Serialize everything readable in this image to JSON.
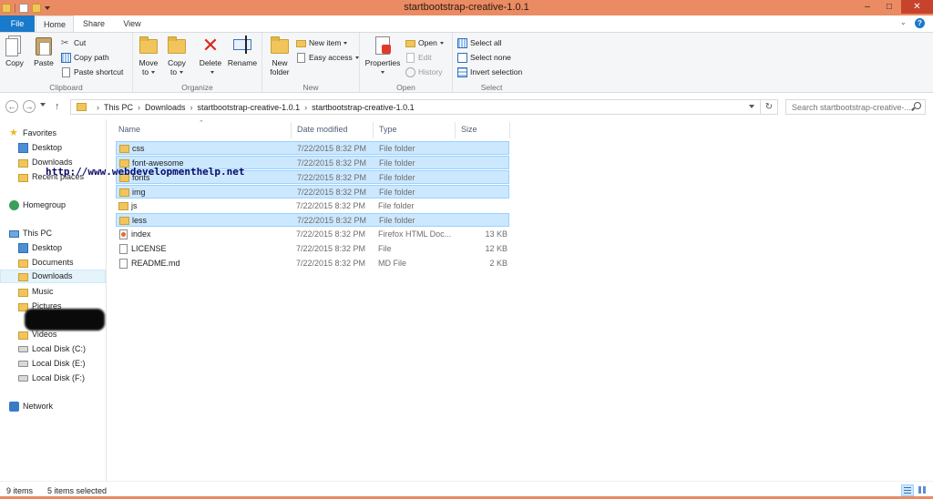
{
  "window": {
    "title": "startbootstrap-creative-1.0.1",
    "minimize": "–",
    "maximize": "□",
    "close": "✕"
  },
  "tabs": [
    "File",
    "Home",
    "Share",
    "View"
  ],
  "ribbon": {
    "clipboard": {
      "label": "Clipboard",
      "copy": "Copy",
      "paste": "Paste",
      "cut": "Cut",
      "copy_path": "Copy path",
      "paste_shortcut": "Paste shortcut"
    },
    "organize": {
      "label": "Organize",
      "move_to": "Move",
      "move_to_2": "to",
      "copy_to": "Copy",
      "copy_to_2": "to",
      "delete": "Delete",
      "rename": "Rename"
    },
    "new": {
      "label": "New",
      "new_folder": "New",
      "new_folder_2": "folder",
      "new_item": "New item",
      "easy_access": "Easy access"
    },
    "open": {
      "label": "Open",
      "properties": "Properties",
      "open": "Open",
      "edit": "Edit",
      "history": "History"
    },
    "select": {
      "label": "Select",
      "select_all": "Select all",
      "select_none": "Select none",
      "invert_selection": "Invert selection"
    }
  },
  "address": {
    "breadcrumbs": [
      "This PC",
      "Downloads",
      "startbootstrap-creative-1.0.1",
      "startbootstrap-creative-1.0.1"
    ],
    "search_placeholder": "Search startbootstrap-creative-..."
  },
  "nav": {
    "favorites": "Favorites",
    "desktop": "Desktop",
    "downloads": "Downloads",
    "recent_places": "Recent places",
    "homegroup": "Homegroup",
    "this_pc": "This PC",
    "pc_desktop": "Desktop",
    "documents": "Documents",
    "pc_downloads": "Downloads",
    "music": "Music",
    "pictures": "Pictures",
    "videos": "Videos",
    "disk_c": "Local Disk (C:)",
    "disk_e": "Local Disk (E:)",
    "disk_f": "Local Disk (F:)",
    "network": "Network"
  },
  "columns": {
    "name": "Name",
    "date": "Date modified",
    "type": "Type",
    "size": "Size"
  },
  "files": [
    {
      "name": "css",
      "date": "7/22/2015 8:32 PM",
      "type": "File folder",
      "size": ""
    },
    {
      "name": "font-awesome",
      "date": "7/22/2015 8:32 PM",
      "type": "File folder",
      "size": ""
    },
    {
      "name": "fonts",
      "date": "7/22/2015 8:32 PM",
      "type": "File folder",
      "size": ""
    },
    {
      "name": "img",
      "date": "7/22/2015 8:32 PM",
      "type": "File folder",
      "size": ""
    },
    {
      "name": "js",
      "date": "7/22/2015 8:32 PM",
      "type": "File folder",
      "size": ""
    },
    {
      "name": "less",
      "date": "7/22/2015 8:32 PM",
      "type": "File folder",
      "size": ""
    },
    {
      "name": "index",
      "date": "7/22/2015 8:32 PM",
      "type": "Firefox HTML Doc...",
      "size": "13 KB"
    },
    {
      "name": "LICENSE",
      "date": "7/22/2015 8:32 PM",
      "type": "File",
      "size": "12 KB"
    },
    {
      "name": "README.md",
      "date": "7/22/2015 8:32 PM",
      "type": "MD File",
      "size": "2 KB"
    }
  ],
  "watermark": "http://www.webdevelopmenthelp.net",
  "status": {
    "count": "9 items",
    "selected": "5 items selected"
  },
  "icons": {
    "folder": "folder-icon",
    "file": "file-icon",
    "firefox_doc": "firefox-document-icon"
  }
}
